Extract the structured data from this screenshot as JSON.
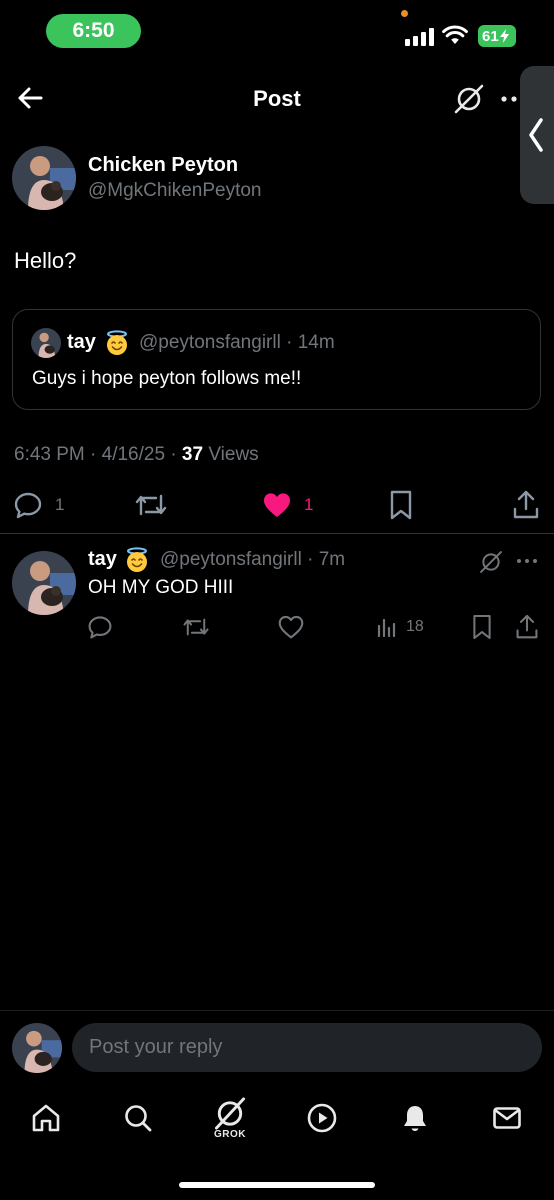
{
  "status_bar": {
    "time": "6:50",
    "battery": "61",
    "colors": {
      "time_pill": "#3bc35c",
      "battery": "#3bc35c",
      "indicator_dot": "#f08a24"
    },
    "icons": [
      "cellular-signal-icon",
      "wifi-icon",
      "battery-charging-icon"
    ]
  },
  "header": {
    "title": "Post",
    "icons": [
      "back-arrow-icon",
      "grok-icon",
      "more-icon",
      "chevron-left-icon"
    ]
  },
  "post": {
    "author_name": "Chicken Peyton",
    "author_handle": "@MgkChikenPeyton",
    "text": "Hello?",
    "quote": {
      "name": "tay",
      "emoji": "smiling-face-with-halo",
      "handle_time": "@peytonsfangirll · 14m",
      "text": "Guys i hope peyton follows me!!"
    },
    "timestamp": "6:43 PM · 4/16/25 · ",
    "views_count": "37",
    "views_label": " Views",
    "actions": {
      "replies": "1",
      "reposts": "",
      "likes": "1",
      "liked": true,
      "like_color": "#f91880"
    }
  },
  "reply": {
    "name": "tay",
    "emoji": "smiling-face-with-halo",
    "handle_time": "@peytonsfangirll · 7m",
    "text": "OH MY GOD HIII",
    "views": "18"
  },
  "composer": {
    "placeholder": "Post your reply"
  },
  "tabbar": {
    "grok_label": "GROK",
    "icons": [
      "home-icon",
      "search-icon",
      "grok-icon",
      "video-icon",
      "notifications-icon",
      "messages-icon"
    ]
  }
}
